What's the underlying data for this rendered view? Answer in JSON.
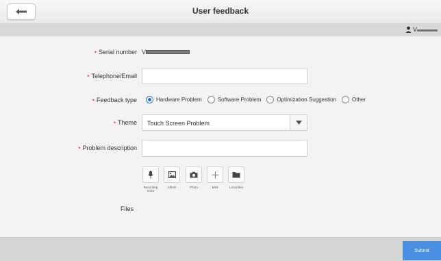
{
  "header": {
    "title": "User feedback",
    "back_icon": "back-arrow-icon"
  },
  "user": {
    "prefix": "V"
  },
  "form": {
    "serial": {
      "label": "Serial number",
      "prefix": "V"
    },
    "contact": {
      "label": "Telephone/Email",
      "value": ""
    },
    "feedback_type": {
      "label": "Feedback type",
      "options": [
        "Hardware Problem",
        "Software Problem",
        "Optimization Suggestion",
        "Other"
      ],
      "selected": "Hardware Problem"
    },
    "theme": {
      "label": "Theme",
      "value": "Touch Screen Problem"
    },
    "problem_description": {
      "label": "Problem description",
      "value": ""
    }
  },
  "attachments": [
    {
      "icon": "microphone-icon",
      "label": "Recording Voice"
    },
    {
      "icon": "image-icon",
      "label": "Album"
    },
    {
      "icon": "camera-icon",
      "label": "Photo"
    },
    {
      "icon": "plus-icon",
      "label": "Mint"
    },
    {
      "icon": "folder-icon",
      "label": "Local files"
    }
  ],
  "files": {
    "label": "Files"
  },
  "footer": {
    "submit_label": "Submit"
  },
  "colors": {
    "accent": "#4a90e2",
    "radio_selected": "#2a6fd6",
    "required": "#e04b4b",
    "background": "#f3f3f3",
    "bar": "#d6d6d6"
  }
}
